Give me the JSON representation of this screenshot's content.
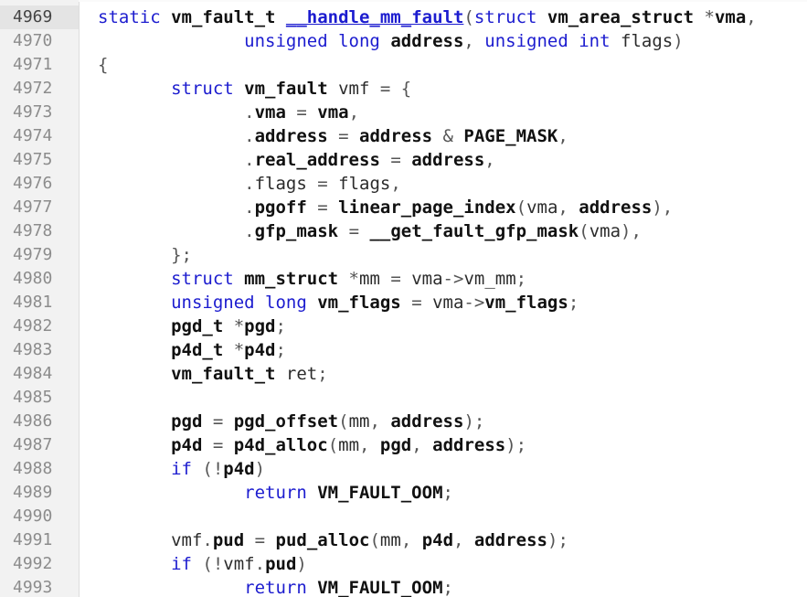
{
  "editor": {
    "lines": [
      {
        "n": "4969",
        "current": true,
        "segs": [
          [
            "static ",
            "kw"
          ],
          [
            "vm_fault_t",
            "b"
          ],
          [
            " ",
            ""
          ],
          [
            "__handle_mm_fault",
            "fn"
          ],
          [
            "(",
            "p"
          ],
          [
            "struct ",
            "kw"
          ],
          [
            "vm_area_struct",
            "b"
          ],
          [
            " *",
            "p"
          ],
          [
            "vma",
            "b"
          ],
          [
            ",",
            "p"
          ]
        ]
      },
      {
        "n": "4970",
        "segs": [
          [
            "              ",
            ""
          ],
          [
            "unsigned ",
            "kw"
          ],
          [
            "long ",
            "kw"
          ],
          [
            "address",
            "b"
          ],
          [
            ", ",
            "p"
          ],
          [
            "unsigned ",
            "kw"
          ],
          [
            "int ",
            "kw"
          ],
          [
            "flags",
            ""
          ],
          [
            ")",
            "p"
          ]
        ]
      },
      {
        "n": "4971",
        "segs": [
          [
            "{",
            "p"
          ]
        ]
      },
      {
        "n": "4972",
        "segs": [
          [
            "       ",
            ""
          ],
          [
            "struct ",
            "kw"
          ],
          [
            "vm_fault",
            "b"
          ],
          [
            " vmf ",
            ""
          ],
          [
            "= {",
            "p"
          ]
        ]
      },
      {
        "n": "4973",
        "segs": [
          [
            "              ",
            ""
          ],
          [
            ".",
            "p"
          ],
          [
            "vma",
            "b"
          ],
          [
            " = ",
            "p"
          ],
          [
            "vma",
            "b"
          ],
          [
            ",",
            "p"
          ]
        ]
      },
      {
        "n": "4974",
        "segs": [
          [
            "              ",
            ""
          ],
          [
            ".",
            "p"
          ],
          [
            "address",
            "b"
          ],
          [
            " = ",
            "p"
          ],
          [
            "address",
            "b"
          ],
          [
            " & ",
            "p"
          ],
          [
            "PAGE_MASK",
            "b"
          ],
          [
            ",",
            "p"
          ]
        ]
      },
      {
        "n": "4975",
        "segs": [
          [
            "              ",
            ""
          ],
          [
            ".",
            "p"
          ],
          [
            "real_address",
            "b"
          ],
          [
            " = ",
            "p"
          ],
          [
            "address",
            "b"
          ],
          [
            ",",
            "p"
          ]
        ]
      },
      {
        "n": "4976",
        "segs": [
          [
            "              ",
            ""
          ],
          [
            ".",
            "p"
          ],
          [
            "flags",
            ""
          ],
          [
            " = ",
            "p"
          ],
          [
            "flags",
            ""
          ],
          [
            ",",
            "p"
          ]
        ]
      },
      {
        "n": "4977",
        "segs": [
          [
            "              ",
            ""
          ],
          [
            ".",
            "p"
          ],
          [
            "pgoff",
            "b"
          ],
          [
            " = ",
            "p"
          ],
          [
            "linear_page_index",
            "b"
          ],
          [
            "(",
            "p"
          ],
          [
            "vma",
            ""
          ],
          [
            ", ",
            "p"
          ],
          [
            "address",
            "b"
          ],
          [
            "),",
            "p"
          ]
        ]
      },
      {
        "n": "4978",
        "segs": [
          [
            "              ",
            ""
          ],
          [
            ".",
            "p"
          ],
          [
            "gfp_mask",
            "b"
          ],
          [
            " = ",
            "p"
          ],
          [
            "__get_fault_gfp_mask",
            "b"
          ],
          [
            "(",
            "p"
          ],
          [
            "vma",
            ""
          ],
          [
            "),",
            "p"
          ]
        ]
      },
      {
        "n": "4979",
        "segs": [
          [
            "       ",
            ""
          ],
          [
            "};",
            "p"
          ]
        ]
      },
      {
        "n": "4980",
        "segs": [
          [
            "       ",
            ""
          ],
          [
            "struct ",
            "kw"
          ],
          [
            "mm_struct",
            "b"
          ],
          [
            " *",
            "p"
          ],
          [
            "mm",
            ""
          ],
          [
            " = ",
            "p"
          ],
          [
            "vma",
            ""
          ],
          [
            "->",
            "p"
          ],
          [
            "vm_mm",
            ""
          ],
          [
            ";",
            "p"
          ]
        ]
      },
      {
        "n": "4981",
        "segs": [
          [
            "       ",
            ""
          ],
          [
            "unsigned ",
            "kw"
          ],
          [
            "long ",
            "kw"
          ],
          [
            "vm_flags",
            "b"
          ],
          [
            " = ",
            "p"
          ],
          [
            "vma",
            ""
          ],
          [
            "->",
            "p"
          ],
          [
            "vm_flags",
            "b"
          ],
          [
            ";",
            "p"
          ]
        ]
      },
      {
        "n": "4982",
        "segs": [
          [
            "       ",
            ""
          ],
          [
            "pgd_t",
            "b"
          ],
          [
            " *",
            "p"
          ],
          [
            "pgd",
            "b"
          ],
          [
            ";",
            "p"
          ]
        ]
      },
      {
        "n": "4983",
        "segs": [
          [
            "       ",
            ""
          ],
          [
            "p4d_t",
            "b"
          ],
          [
            " *",
            "p"
          ],
          [
            "p4d",
            "b"
          ],
          [
            ";",
            "p"
          ]
        ]
      },
      {
        "n": "4984",
        "segs": [
          [
            "       ",
            ""
          ],
          [
            "vm_fault_t",
            "b"
          ],
          [
            " ret",
            ""
          ],
          [
            ";",
            "p"
          ]
        ]
      },
      {
        "n": "4985",
        "segs": []
      },
      {
        "n": "4986",
        "segs": [
          [
            "       ",
            ""
          ],
          [
            "pgd",
            "b"
          ],
          [
            " = ",
            "p"
          ],
          [
            "pgd_offset",
            "b"
          ],
          [
            "(",
            "p"
          ],
          [
            "mm",
            ""
          ],
          [
            ", ",
            "p"
          ],
          [
            "address",
            "b"
          ],
          [
            ");",
            "p"
          ]
        ]
      },
      {
        "n": "4987",
        "segs": [
          [
            "       ",
            ""
          ],
          [
            "p4d",
            "b"
          ],
          [
            " = ",
            "p"
          ],
          [
            "p4d_alloc",
            "b"
          ],
          [
            "(",
            "p"
          ],
          [
            "mm",
            ""
          ],
          [
            ", ",
            "p"
          ],
          [
            "pgd",
            "b"
          ],
          [
            ", ",
            "p"
          ],
          [
            "address",
            "b"
          ],
          [
            ");",
            "p"
          ]
        ]
      },
      {
        "n": "4988",
        "segs": [
          [
            "       ",
            ""
          ],
          [
            "if ",
            "kw"
          ],
          [
            "(!",
            "p"
          ],
          [
            "p4d",
            "b"
          ],
          [
            ")",
            "p"
          ]
        ]
      },
      {
        "n": "4989",
        "segs": [
          [
            "              ",
            ""
          ],
          [
            "return ",
            "kw"
          ],
          [
            "VM_FAULT_OOM",
            "b"
          ],
          [
            ";",
            "p"
          ]
        ]
      },
      {
        "n": "4990",
        "segs": []
      },
      {
        "n": "4991",
        "segs": [
          [
            "       ",
            ""
          ],
          [
            "vmf",
            ""
          ],
          [
            ".",
            "p"
          ],
          [
            "pud",
            "b"
          ],
          [
            " = ",
            "p"
          ],
          [
            "pud_alloc",
            "b"
          ],
          [
            "(",
            "p"
          ],
          [
            "mm",
            ""
          ],
          [
            ", ",
            "p"
          ],
          [
            "p4d",
            "b"
          ],
          [
            ", ",
            "p"
          ],
          [
            "address",
            "b"
          ],
          [
            ");",
            "p"
          ]
        ]
      },
      {
        "n": "4992",
        "segs": [
          [
            "       ",
            ""
          ],
          [
            "if ",
            "kw"
          ],
          [
            "(!",
            "p"
          ],
          [
            "vmf",
            ""
          ],
          [
            ".",
            "p"
          ],
          [
            "pud",
            "b"
          ],
          [
            ")",
            "p"
          ]
        ]
      },
      {
        "n": "4993",
        "segs": [
          [
            "              ",
            ""
          ],
          [
            "return ",
            "kw"
          ],
          [
            "VM_FAULT_OOM",
            "b"
          ],
          [
            ";",
            "p"
          ]
        ]
      }
    ]
  }
}
